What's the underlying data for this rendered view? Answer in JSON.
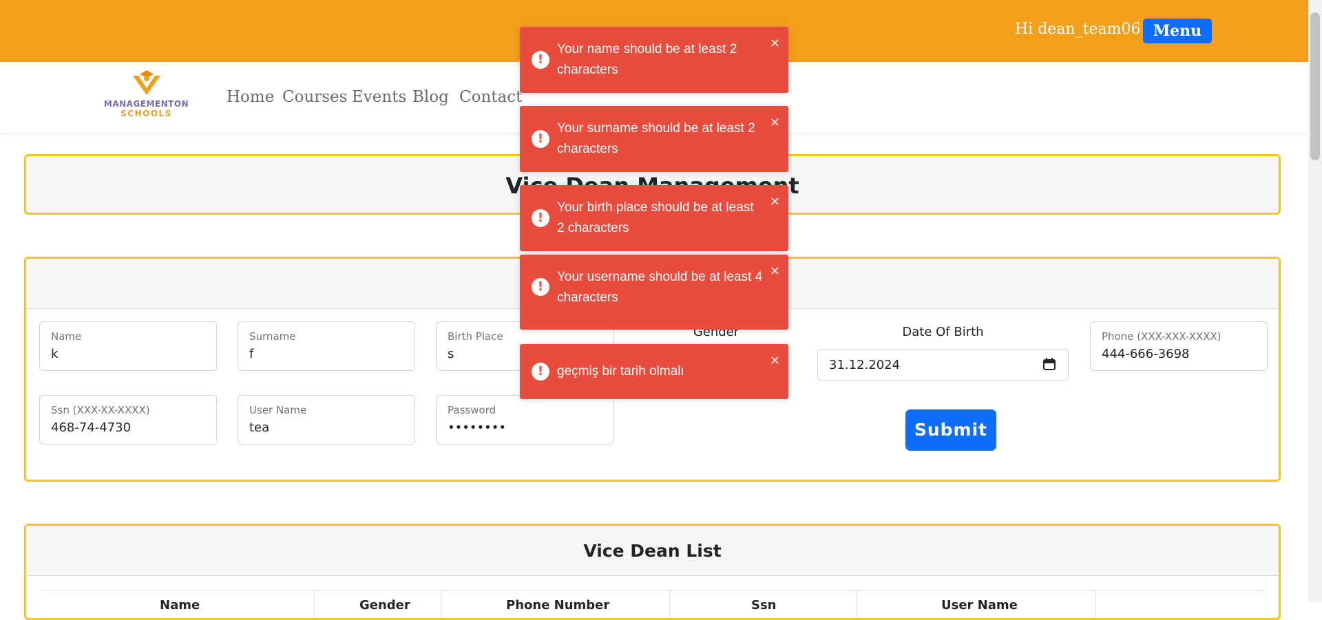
{
  "header": {
    "greeting": "Hi dean_team06",
    "menu_label": "Menu"
  },
  "brand": {
    "line1": "MANAGEMENTON",
    "line2": "SCHOOLS",
    "logo_icon": "graduate-cap-icon"
  },
  "nav": {
    "items": [
      "Home",
      "Courses",
      "Events",
      "Blog",
      "Contact"
    ]
  },
  "page": {
    "title": "Vice Dean Management"
  },
  "form": {
    "name": {
      "label": "Name",
      "value": "k"
    },
    "surname": {
      "label": "Surname",
      "value": "f"
    },
    "birth_place": {
      "label": "Birth Place",
      "value": "s"
    },
    "gender": {
      "label": "Gender"
    },
    "date_of_birth": {
      "label": "Date Of Birth",
      "value": "31.12.2024"
    },
    "phone": {
      "label": "Phone (XXX-XXX-XXXX)",
      "value": "444-666-3698"
    },
    "ssn": {
      "label": "Ssn (XXX-XX-XXXX)",
      "value": "468-74-4730"
    },
    "username": {
      "label": "User Name",
      "value": "tea"
    },
    "password": {
      "label": "Password",
      "value": "••••••••"
    },
    "submit_label": "Submit"
  },
  "list": {
    "title": "Vice Dean List",
    "columns": [
      "Name",
      "Gender",
      "Phone Number",
      "Ssn",
      "User Name",
      ""
    ]
  },
  "toasts": [
    {
      "message": "Your name should be at least 2 characters"
    },
    {
      "message": "Your surname should be at least 2 characters"
    },
    {
      "message": "Your birth place should be at least 2 characters"
    },
    {
      "message": "Your username should be at least 4 characters"
    },
    {
      "message": "geçmiş bir tarih olmalı"
    }
  ],
  "colors": {
    "header": "#f49f1c",
    "primary": "#0d6efd",
    "toast_error": "#e74c3c",
    "panel_border": "#f5c518"
  }
}
